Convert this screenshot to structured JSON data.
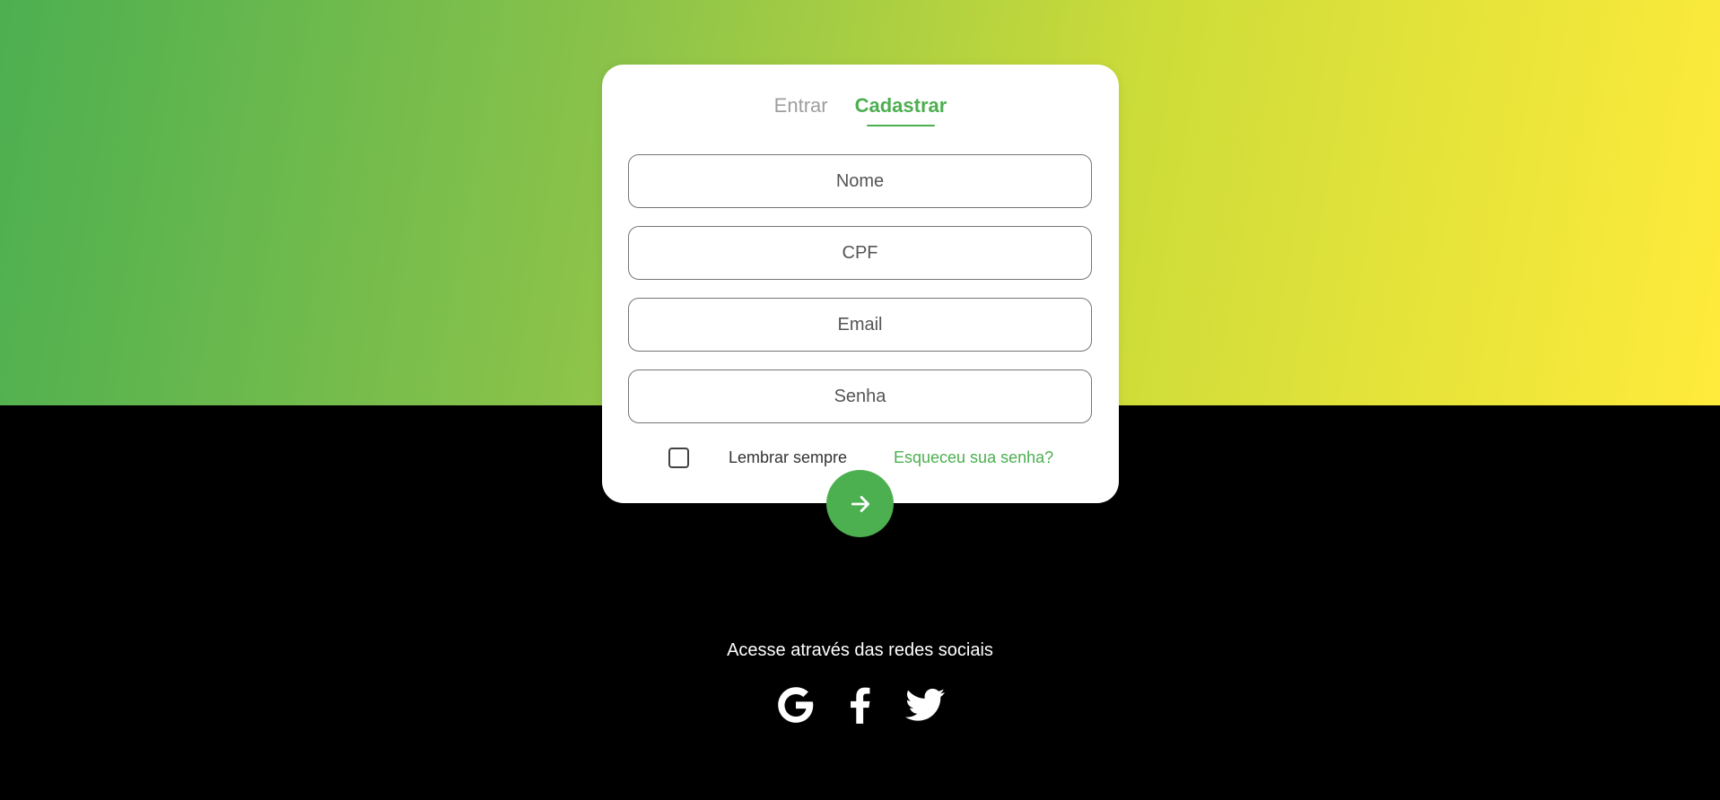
{
  "tabs": {
    "login_label": "Entrar",
    "signup_label": "Cadastrar",
    "active": "signup"
  },
  "form": {
    "name_placeholder": "Nome",
    "cpf_placeholder": "CPF",
    "email_placeholder": "Email",
    "password_placeholder": "Senha",
    "remember_label": "Lembrar sempre",
    "remember_checked": false,
    "forgot_label": "Esqueceu sua senha?",
    "submit_icon": "arrow-right-icon"
  },
  "social": {
    "title": "Acesse através das redes sociais",
    "icons": [
      "google-icon",
      "facebook-icon",
      "twitter-icon"
    ]
  },
  "colors": {
    "accent": "#4caf50",
    "gradient_start": "#4caf50",
    "gradient_end": "#ffeb3b",
    "background": "#000000",
    "card": "#ffffff"
  }
}
